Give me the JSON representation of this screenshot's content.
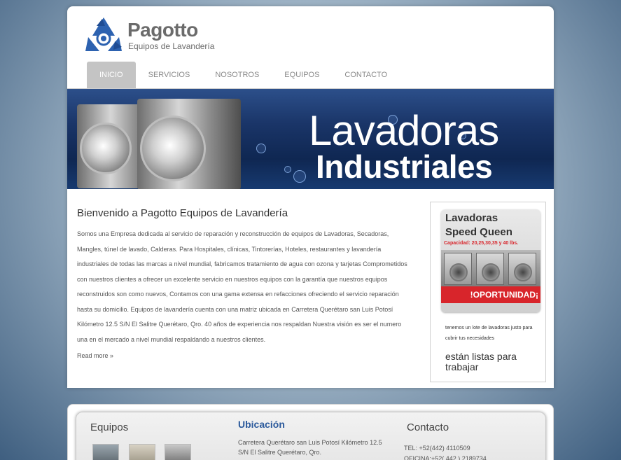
{
  "brand": {
    "name": "Pagotto",
    "tagline": "Equipos de Lavandería"
  },
  "nav": {
    "items": [
      {
        "label": "INICIO",
        "active": true
      },
      {
        "label": "SERVICIOS",
        "active": false
      },
      {
        "label": "NOSOTROS",
        "active": false
      },
      {
        "label": "EQUIPOS",
        "active": false
      },
      {
        "label": "CONTACTO",
        "active": false
      }
    ]
  },
  "banner": {
    "line1": "Lavadoras",
    "line2": "Industriales"
  },
  "welcome": {
    "title": "Bienvenido a Pagotto Equipos de Lavandería",
    "body": "Somos una Empresa dedicada al servicio de reparación y reconstrucción de equipos de Lavadoras, Secadoras, Mangles, túnel de lavado, Calderas. Para Hospitales, clínicas, Tintorerías, Hoteles, restaurantes y lavandería industriales de todas las marcas a nivel mundial, fabricamos tratamiento de agua con ozona y tarjetas Comprometidos con nuestros clientes a ofrecer un excelente servicio en nuestros equipos con la garantía que nuestros equipos reconstruidos son como nuevos, Contamos con una gama extensa en refacciones ofreciendo el servicio reparación hasta su domicilio. Equipos de lavandería cuenta con una matriz ubicada en Carretera Querétaro san Luis Potosí Kilómetro 12.5 S/N El Salitre Querétaro, Qro. 40 años de experiencia nos respaldan Nuestra visión es ser el numero una en el mercado a nivel mundial respaldando a nuestros clientes.",
    "read_more": "Read more »"
  },
  "promo": {
    "heading1": "Lavadoras",
    "heading2": "Speed Queen",
    "capacity": "Capacidad: 20,25,30,35 y 40 lbs.",
    "band": "!OPORTUNIDAD¡",
    "text1": "tenemos un lote de lavadoras justo para cubrir tus necesidades",
    "text2": "están listas para trabajar",
    "colors": {
      "band": "#d8252b",
      "capacity": "#d8252b"
    }
  },
  "footer": {
    "equipos_title": "Equipos",
    "ubicacion_title": "Ubicación",
    "ubicacion_text": "Carretera Querétaro san Luis Potosí Kilómetro 12.5 S/N El Salitre Querétaro, Qro.",
    "contacto_title": "Contacto",
    "tel": "TEL: +52(442) 4110509",
    "oficina": "OFICINA:+52( 442 ) 2189734"
  }
}
